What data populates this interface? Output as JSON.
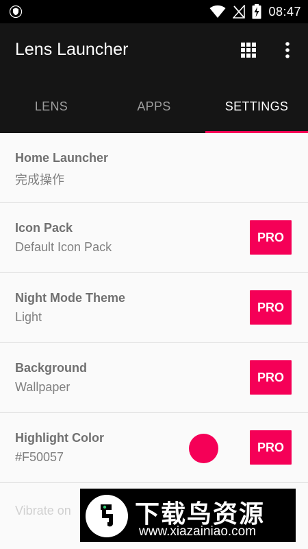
{
  "status_bar": {
    "time": "08:47",
    "icons": [
      "shield-icon",
      "wifi-icon",
      "no-signal-icon",
      "battery-charging-icon"
    ]
  },
  "app_bar": {
    "title": "Lens Launcher",
    "actions": [
      "grid-icon",
      "more-vert-icon"
    ]
  },
  "tabs": [
    {
      "label": "LENS",
      "active": false
    },
    {
      "label": "APPS",
      "active": false
    },
    {
      "label": "SETTINGS",
      "active": true
    }
  ],
  "settings": {
    "home_launcher": {
      "title": "Home Launcher",
      "subtitle": "完成操作"
    },
    "icon_pack": {
      "title": "Icon Pack",
      "subtitle": "Default Icon Pack",
      "badge": "PRO"
    },
    "night_mode": {
      "title": "Night Mode Theme",
      "subtitle": "Light",
      "badge": "PRO"
    },
    "background": {
      "title": "Background",
      "subtitle": "Wallpaper",
      "badge": "PRO"
    },
    "highlight_color": {
      "title": "Highlight Color",
      "subtitle": "#F50057",
      "badge": "PRO",
      "swatch": "#F50057"
    },
    "vibrate": {
      "title": "Vibrate on"
    }
  },
  "watermark": {
    "title": "下载鸟资源",
    "url": "www.xiazainiao.com"
  },
  "colors": {
    "accent": "#F50057",
    "app_bar": "#151515",
    "status_bar": "#000000"
  }
}
